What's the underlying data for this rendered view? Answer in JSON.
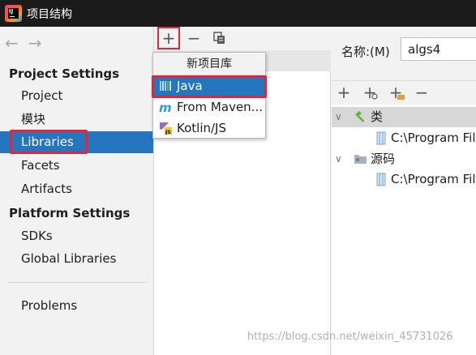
{
  "window": {
    "title": "项目结构",
    "logo_icon": "intellij-logo-icon"
  },
  "nav": {
    "back_icon": "arrow-left-icon",
    "forward_icon": "arrow-right-icon"
  },
  "sidebar": {
    "project_settings_header": "Project Settings",
    "platform_settings_header": "Platform Settings",
    "items": [
      {
        "label": "Project"
      },
      {
        "label": "模块"
      },
      {
        "label": "Libraries",
        "selected": true
      },
      {
        "label": "Facets"
      },
      {
        "label": "Artifacts"
      },
      {
        "label": "SDKs"
      },
      {
        "label": "Global Libraries"
      },
      {
        "label": "Problems"
      }
    ]
  },
  "middle_toolbar": {
    "add": "+",
    "remove": "−",
    "copy_icon": "copy-icon"
  },
  "new_library_popup": {
    "title": "新项目库",
    "items": [
      {
        "label": "Java",
        "icon": "java-library-icon",
        "selected": true
      },
      {
        "label": "From Maven...",
        "icon": "maven-icon"
      },
      {
        "label": "Kotlin/JS",
        "icon": "kotlin-js-icon"
      }
    ]
  },
  "detail": {
    "name_label": "名称:(M)",
    "name_value": "algs4",
    "toolbar": [
      "+",
      "+",
      "+",
      "−"
    ],
    "tree": {
      "classes_label": "类",
      "classes_path": "C:\\Program Files",
      "sources_label": "源码",
      "sources_path": "C:\\Program Files"
    }
  },
  "watermark": "https://blog.csdn.net/weixin_45731026",
  "colors": {
    "selection": "#2675bf",
    "highlight": "#e0263a",
    "titlebar": "#1b1b1b"
  }
}
